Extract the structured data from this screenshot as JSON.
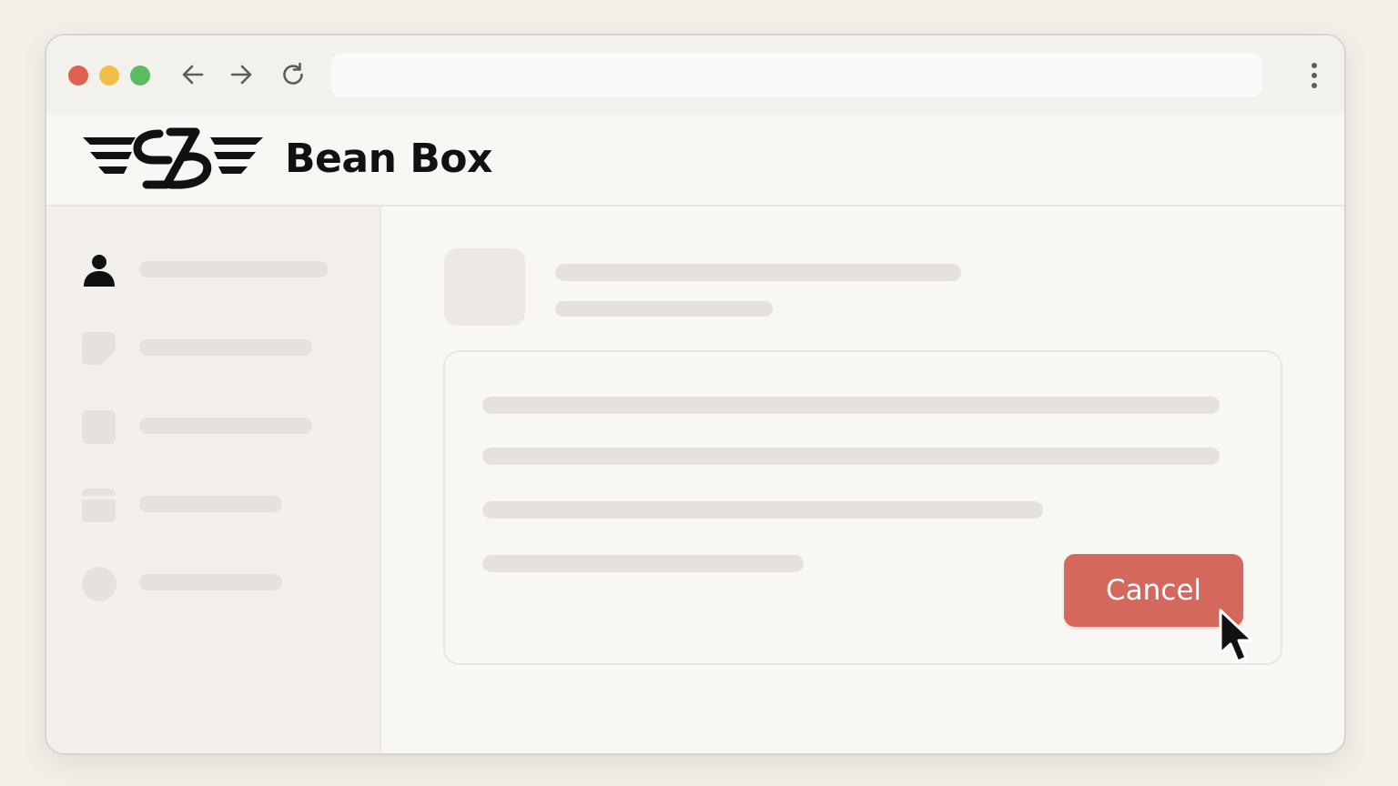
{
  "browser": {
    "controls": {
      "close_color": "#e06150",
      "minimize_color": "#f1bf45",
      "maximize_color": "#5cbc62"
    },
    "nav_icons": [
      "back-arrow-icon",
      "forward-arrow-icon",
      "reload-icon"
    ],
    "address_bar": {
      "value": "",
      "placeholder": ""
    },
    "menu_icon": "kebab-menu-icon"
  },
  "header": {
    "logo_icon": "winged-rb-monogram-logo",
    "brand_name": "Bean Box"
  },
  "sidebar": {
    "items": [
      {
        "icon": "user-icon",
        "active": true
      },
      {
        "icon": "note-icon",
        "active": false
      },
      {
        "icon": "square-icon",
        "active": false
      },
      {
        "icon": "box-icon",
        "active": false
      },
      {
        "icon": "circle-icon",
        "active": false
      }
    ]
  },
  "main": {
    "card": {
      "cancel_label": "Cancel"
    }
  },
  "colors": {
    "page_background": "#f3efe9",
    "window_background": "#f8f7f4",
    "sidebar_background": "#f3f0eb",
    "placeholder": "#e6e1dc",
    "accent": "#d5685d",
    "active_icon": "#111111"
  }
}
